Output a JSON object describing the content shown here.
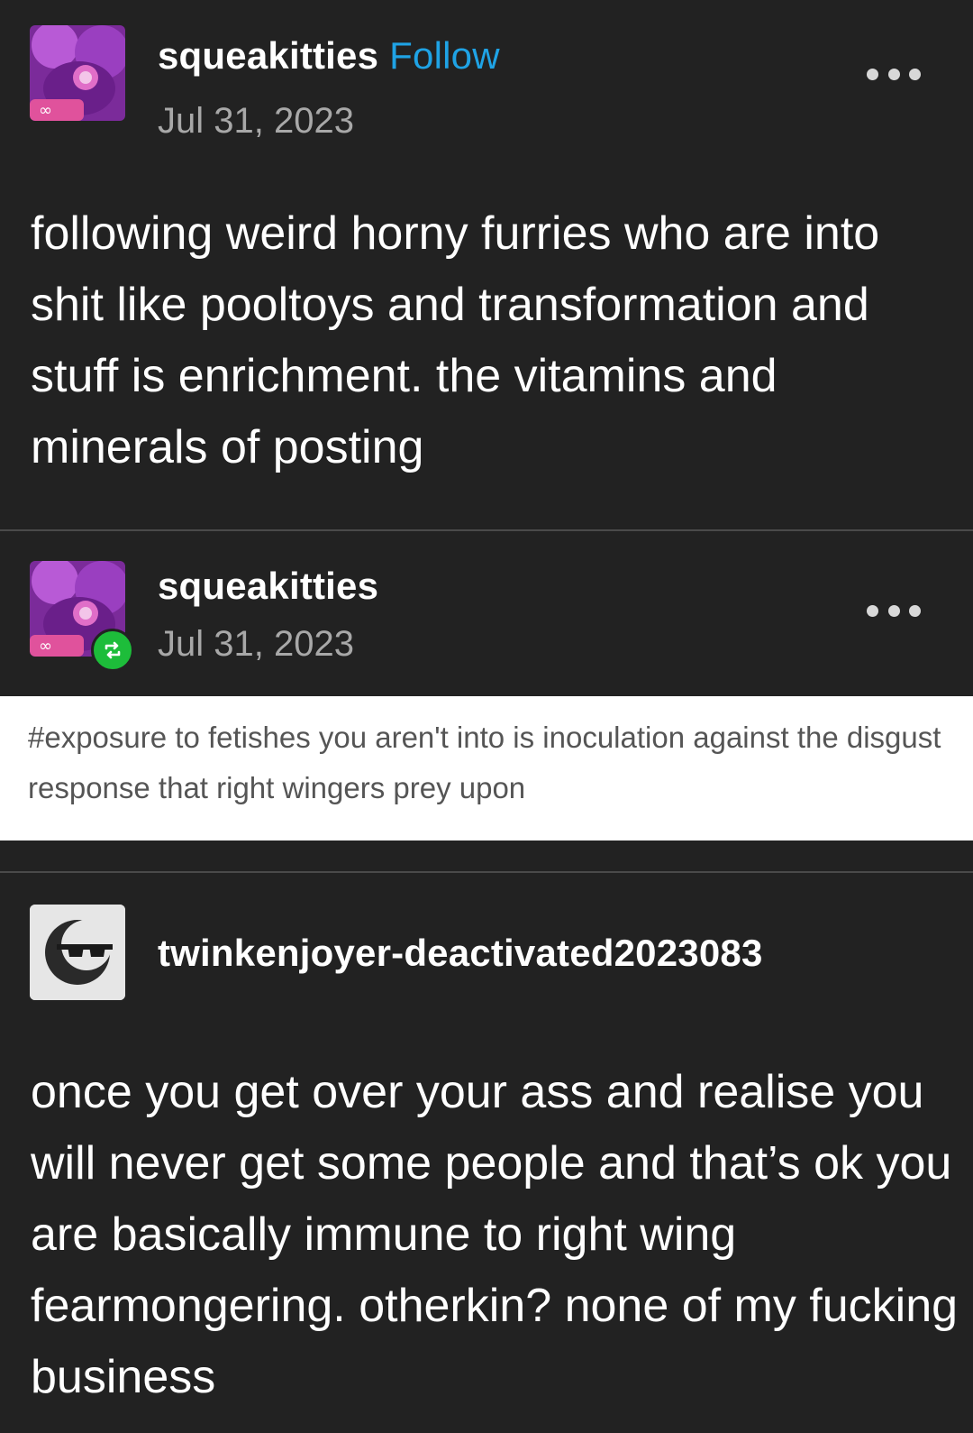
{
  "post1": {
    "username": "squeakitties",
    "follow_label": "Follow",
    "date": "Jul 31, 2023",
    "avatar_icon": "purple-creature-avatar-icon",
    "more_icon": "more-options-icon",
    "body": "following weird horny furries who are into shit like pooltoys and transformation and stuff is enrichment. the vitamins and minerals of posting"
  },
  "post2": {
    "username": "squeakitties",
    "date": "Jul 31, 2023",
    "avatar_icon": "purple-creature-avatar-icon",
    "reblog_icon": "reblog-icon",
    "more_icon": "more-options-icon",
    "tags": "#exposure to fetishes you aren't into is inoculation against the disgust response that right wingers prey upon"
  },
  "post3": {
    "username": "twinkenjoyer-deactivated2023083",
    "avatar_icon": "sunglasses-moon-avatar-icon",
    "body": "once you get over your ass and realise you will never get some people and that’s ok you are basically immune to right wing fearmongering. otherkin? none of my fucking business"
  },
  "colors": {
    "background": "#222222",
    "follow": "#1fa3e5",
    "date": "#a8a8a8",
    "reblog_badge": "#1dbd3a",
    "tag_box": "#ffffff",
    "tag_text": "#555555"
  }
}
